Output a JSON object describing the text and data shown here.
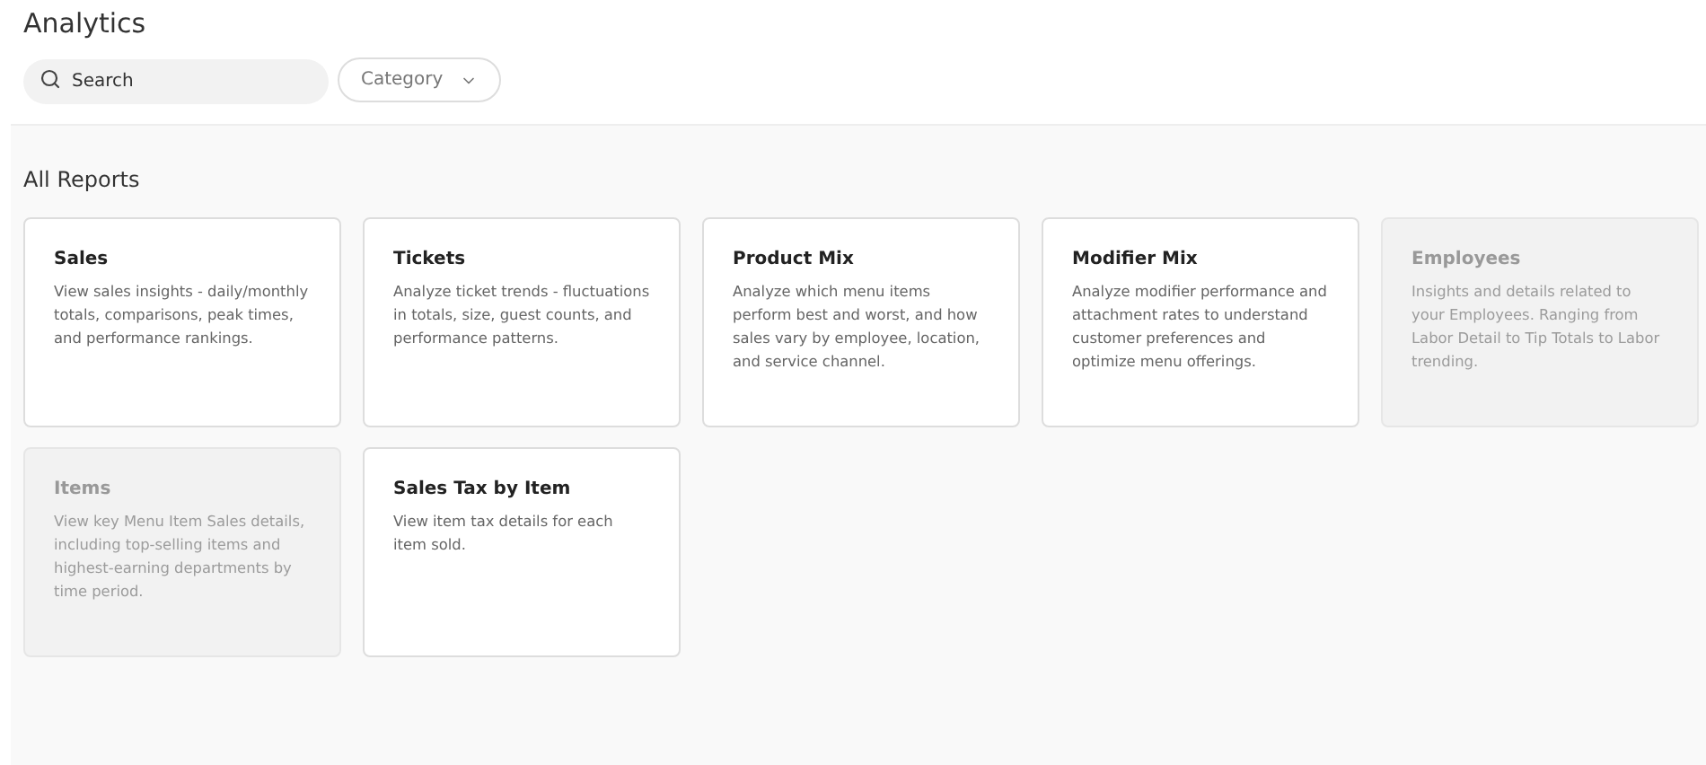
{
  "header": {
    "title": "Analytics"
  },
  "search": {
    "placeholder": "Search"
  },
  "category_filter": {
    "label": "Category"
  },
  "section": {
    "title": "All Reports"
  },
  "reports": [
    {
      "title": "Sales",
      "description": "View sales insights - daily/monthly totals, comparisons, peak times, and performance rankings.",
      "disabled": false
    },
    {
      "title": "Tickets",
      "description": "Analyze ticket trends - fluctuations in totals, size, guest counts, and performance patterns.",
      "disabled": false
    },
    {
      "title": "Product Mix",
      "description": "Analyze which menu items perform best and worst, and how sales vary by employee, location, and service channel.",
      "disabled": false
    },
    {
      "title": "Modifier Mix",
      "description": "Analyze modifier performance and attachment rates to understand customer preferences and optimize menu offerings.",
      "disabled": false
    },
    {
      "title": "Employees",
      "description": "Insights and details related to your Employees. Ranging from Labor Detail to Tip Totals to Labor trending.",
      "disabled": true
    },
    {
      "title": "Items",
      "description": "View key Menu Item Sales details, including top-selling items and highest-earning departments by time period.",
      "disabled": true
    },
    {
      "title": "Sales Tax by Item",
      "description": "View item tax details for each item sold.",
      "disabled": false
    }
  ]
}
